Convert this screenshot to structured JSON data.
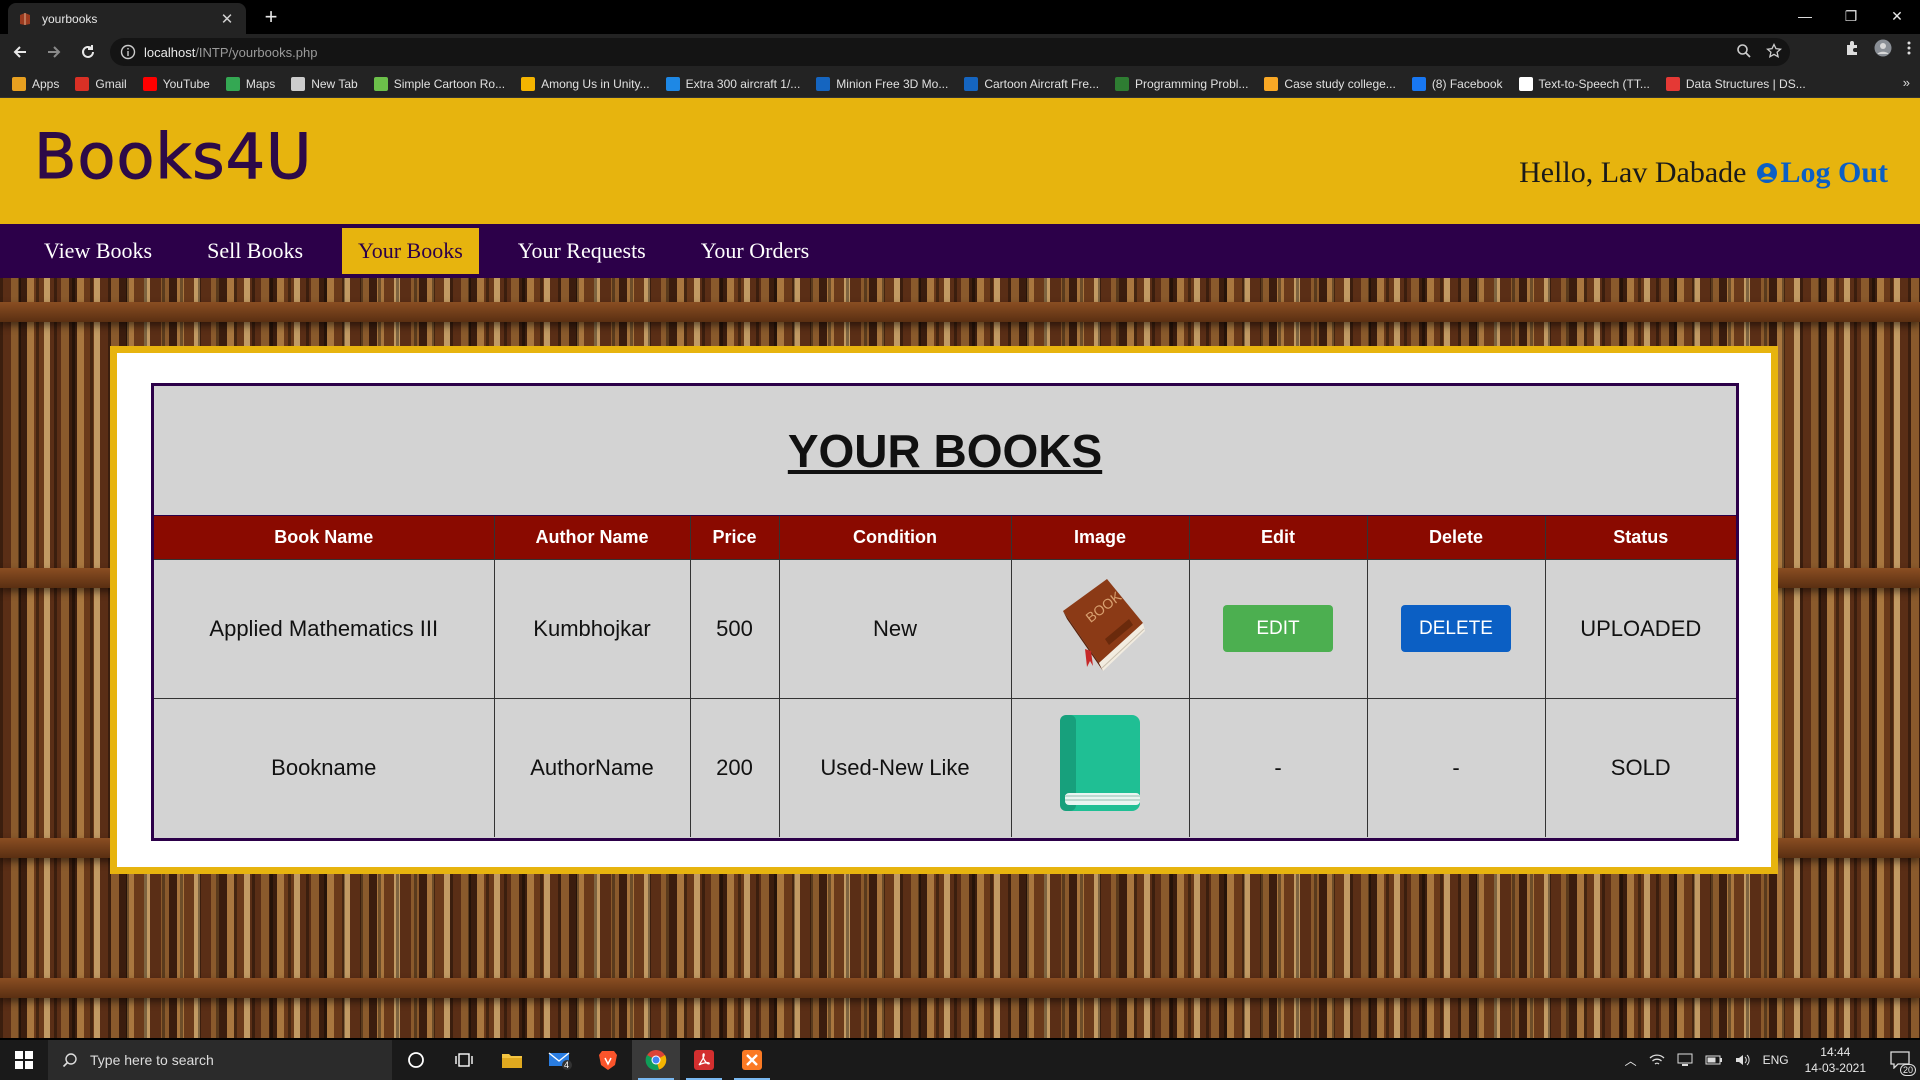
{
  "browser": {
    "tab_title": "yourbooks",
    "url_host": "localhost",
    "url_path": "/INTP/yourbooks.php",
    "bookmarks": [
      {
        "label": "Apps",
        "icon": "apps-grid-icon",
        "color": "#e8a020"
      },
      {
        "label": "Gmail",
        "icon": "gmail-icon",
        "color": "#d93025"
      },
      {
        "label": "YouTube",
        "icon": "youtube-icon",
        "color": "#ff0000"
      },
      {
        "label": "Maps",
        "icon": "maps-icon",
        "color": "#34a853"
      },
      {
        "label": "New Tab",
        "icon": "globe-icon",
        "color": "#cccccc"
      },
      {
        "label": "Simple Cartoon Ro...",
        "icon": "unity-icon",
        "color": "#6cc04a"
      },
      {
        "label": "Among Us in Unity...",
        "icon": "multicolor-icon",
        "color": "#f4b400"
      },
      {
        "label": "Extra 300 aircraft 1/...",
        "icon": "circle-icon",
        "color": "#1e88e5"
      },
      {
        "label": "Minion Free 3D Mo...",
        "icon": "3d-icon",
        "color": "#1565c0"
      },
      {
        "label": "Cartoon Aircraft Fre...",
        "icon": "3d-icon",
        "color": "#1565c0"
      },
      {
        "label": "Programming Probl...",
        "icon": "gg-icon",
        "color": "#2e7d32"
      },
      {
        "label": "Case study college...",
        "icon": "doc-icon",
        "color": "#f9a825"
      },
      {
        "label": "(8) Facebook",
        "icon": "facebook-icon",
        "color": "#1877f2"
      },
      {
        "label": "Text-to-Speech (TT...",
        "icon": "tts-icon",
        "color": "#ffffff"
      },
      {
        "label": "Data Structures | DS...",
        "icon": "triangle-icon",
        "color": "#e53935"
      }
    ]
  },
  "site": {
    "logo": "Books4U",
    "greeting": "Hello, Lav Dabade",
    "logout": "Log Out",
    "nav": [
      {
        "label": "View Books",
        "active": false
      },
      {
        "label": "Sell Books",
        "active": false
      },
      {
        "label": "Your Books",
        "active": true
      },
      {
        "label": "Your Requests",
        "active": false
      },
      {
        "label": "Your Orders",
        "active": false
      }
    ],
    "colors": {
      "header": "#e7b40e",
      "nav": "#2c0049",
      "table_header": "#8a0a00",
      "edit": "#4caf50",
      "delete": "#0b5fc4"
    }
  },
  "table": {
    "title": "YOUR BOOKS",
    "columns": [
      "Book Name",
      "Author Name",
      "Price",
      "Condition",
      "Image",
      "Edit",
      "Delete",
      "Status"
    ],
    "rows": [
      {
        "book_name": "Applied Mathematics III",
        "author": "Kumbhojkar",
        "price": "500",
        "condition": "New",
        "image": "brown-book-icon",
        "edit": "EDIT",
        "delete": "DELETE",
        "status": "UPLOADED"
      },
      {
        "book_name": "Bookname",
        "author": "AuthorName",
        "price": "200",
        "condition": "Used-New Like",
        "image": "green-book-icon",
        "edit": "-",
        "delete": "-",
        "status": "SOLD"
      }
    ]
  },
  "taskbar": {
    "search_placeholder": "Type here to search",
    "language": "ENG",
    "time": "14:44",
    "date": "14-03-2021",
    "mail_badge": "4",
    "notification_count": "20"
  }
}
